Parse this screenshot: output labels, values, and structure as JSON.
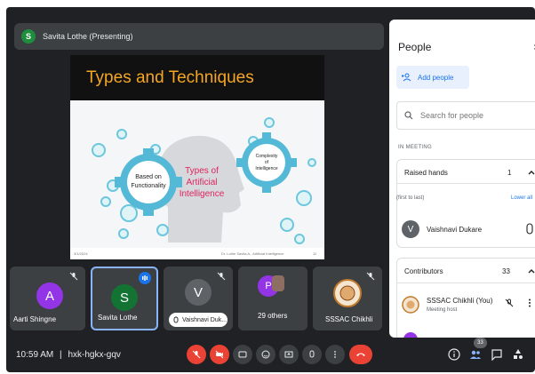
{
  "presenter": {
    "initial": "S",
    "name": "Savita Lothe (Presenting)"
  },
  "slide": {
    "title": "Types and Techniques",
    "center_label": [
      "Types of",
      "Artificial",
      "Intelligence"
    ],
    "left_gear": [
      "Based on",
      "Functionality"
    ],
    "right_gear": [
      "Complexity",
      "of",
      "Intelligence"
    ],
    "footer_left": "3/1/2024",
    "footer_center": "Dr. Lothe Savita A., Artificial Intelligence",
    "footer_right": "11"
  },
  "tiles": [
    {
      "initial": "A",
      "name": "Aarti Shingne",
      "color": "#9334e6"
    },
    {
      "initial": "S",
      "name": "Savita Lothe",
      "color": "#137333"
    },
    {
      "initial": "V",
      "name": "Vaishnavi Duk...",
      "color": "#5f6368"
    },
    {
      "initial": "P",
      "name": "29 others",
      "color": "#9334e6"
    },
    {
      "name": "SSSAC Chikhli"
    }
  ],
  "bottom": {
    "time": "10:59 AM",
    "code": "hxk-hgkx-gqv",
    "people_count": "33"
  },
  "panel": {
    "title": "People",
    "add_people": "Add people",
    "search_placeholder": "Search for people",
    "in_meeting": "IN MEETING",
    "raised_hands": {
      "title": "Raised hands",
      "count": "1",
      "order": "(first to last)",
      "lower_all": "Lower all"
    },
    "raised_person": {
      "initial": "V",
      "name": "Vaishnavi Dukare"
    },
    "contributors": {
      "title": "Contributors",
      "count": "33"
    },
    "host": {
      "name": "SSSAC Chikhli (You)",
      "role": "Meeting host"
    }
  },
  "colors": {
    "accent": "#1a73e8",
    "danger": "#ea4335",
    "bg": "#202124",
    "tile": "#3c4043"
  }
}
